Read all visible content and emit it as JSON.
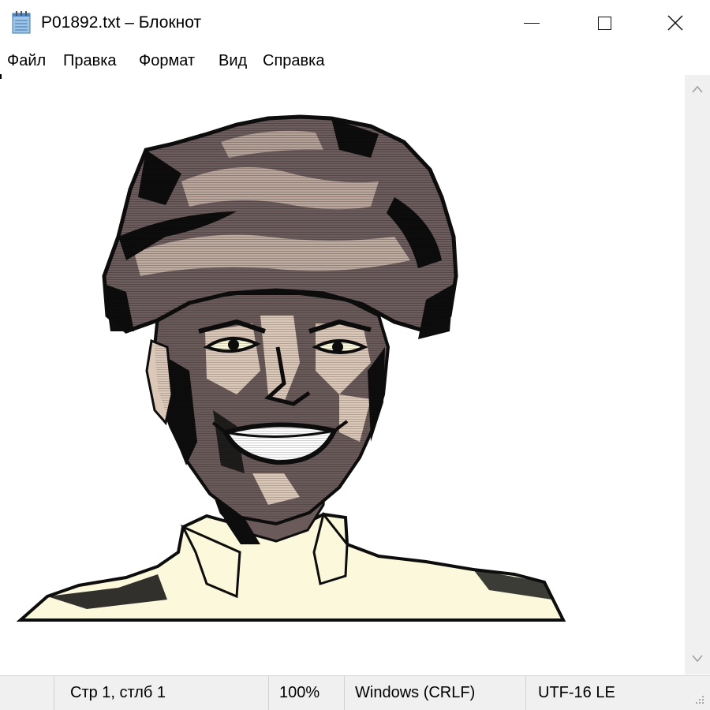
{
  "window": {
    "title": "P01892.txt – Блокнот",
    "icon": "notepad-icon",
    "controls": [
      "minimize-icon",
      "maximize-icon",
      "close-icon"
    ]
  },
  "menu": {
    "items": [
      {
        "label": "Файл"
      },
      {
        "label": "Правка"
      },
      {
        "label": "Формат"
      },
      {
        "label": "Вид"
      },
      {
        "label": "Справка"
      }
    ]
  },
  "editor": {
    "content": "line-art portrait of a smiling man wearing a turban"
  },
  "scrollbar": {
    "up_icon": "chevron-up-icon",
    "down_icon": "chevron-down-icon"
  },
  "status": {
    "position": "Стр 1, стлб 1",
    "zoom": "100%",
    "line_endings": "Windows (CRLF)",
    "encoding": "UTF-16 LE"
  },
  "colors": {
    "ink": "#0d0d0d",
    "turban": "#6e5d5e",
    "skin_shadow": "#6b5a5a",
    "skin_light": "#dcc8b8",
    "shirt": "#fbf8dc",
    "chrome": "#f0f0f0"
  }
}
